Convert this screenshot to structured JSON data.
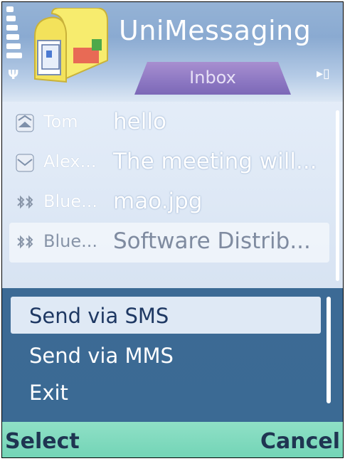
{
  "app": {
    "title": "UniMessaging",
    "tab_label": "Inbox"
  },
  "messages": [
    {
      "sender": "Tom",
      "subject": "hello",
      "icon": "envelope-icon"
    },
    {
      "sender": "Alex...",
      "subject": "The meeting will...",
      "icon": "envelope-icon"
    },
    {
      "sender": "Blue...",
      "subject": "mao.jpg",
      "icon": "bluetooth-icon"
    },
    {
      "sender": "Blue...",
      "subject": "Software Distrib...",
      "icon": "bluetooth-icon"
    }
  ],
  "options_menu": {
    "items": [
      "Send via SMS",
      "Send via MMS",
      "Exit"
    ]
  },
  "softkeys": {
    "left": "Select",
    "right": "Cancel"
  },
  "colors": {
    "menu_bg": "#3b6a94",
    "softkey_bg": "#7ad8bb",
    "tab": "#8c77c2"
  }
}
